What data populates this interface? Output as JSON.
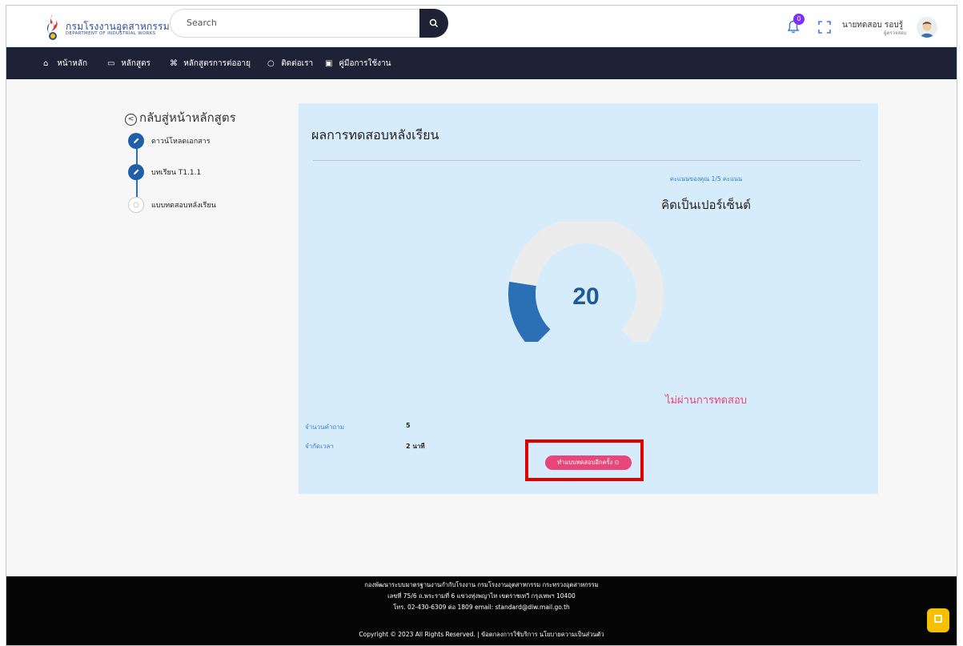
{
  "header": {
    "logo_th": "กรมโรงงานอุตสาหกรรม",
    "logo_en": "DEPARTMENT OF INDUSTRIAL WORKS",
    "search_placeholder": "Search",
    "notification_count": "0",
    "user_name": "นายทดสอบ รอบรู้",
    "user_role": "ผู้ตรวจสอบ"
  },
  "nav": {
    "items": [
      {
        "icon": "home-icon",
        "label": "หน้าหลัก"
      },
      {
        "icon": "monitor-icon",
        "label": "หลักสูตร"
      },
      {
        "icon": "command-icon",
        "label": "หลักสูตรการต่ออายุ"
      },
      {
        "icon": "chat-icon",
        "label": "ติดต่อเรา"
      },
      {
        "icon": "manual-icon",
        "label": "คู่มือการใช้งาน"
      }
    ]
  },
  "sidebar": {
    "back_label": "กลับสู่หน้าหลักสูตร",
    "steps": [
      {
        "label": "ดาวน์โหลดเอกสาร",
        "state": "done"
      },
      {
        "label": "บทเรียน T1.1.1",
        "state": "done"
      },
      {
        "label": "แบบทดสอบหลังเรียน",
        "state": "current"
      }
    ]
  },
  "result": {
    "title": "ผลการทดสอบหลังเรียน",
    "score_text": "คะแนนของคุณ 1/5 คะแนน",
    "percent_label": "คิดเป็นเปอร์เซ็นต์",
    "percent_value": "20",
    "percent_fraction": 0.2,
    "status_text": "ไม่ผ่านการทดสอบ",
    "questions_label": "จำนวนคำถาม",
    "questions_value": "5",
    "time_label": "จำกัดเวลา",
    "time_value": "2 นาที",
    "retry_label": "ทำแบบทดสอบอีกครั้ง"
  },
  "footer": {
    "line1": "กองพัฒนาระบบมาตรฐานงานกำกับโรงงาน กรมโรงงานอุตสาหกรรม กระทรวงอุตสาหกรรม",
    "line2": "เลขที่ 75/6 ถ.พระรามที่ 6 แขวงทุ่งพญาไท เขตราชเทวี กรุงเทพฯ 10400",
    "line3": "โทร. 02-430-6309 ต่อ 1809 email: standard@diw.mail.go.th",
    "copyright": "Copyright © 2023 All Rights Reserved. | ข้อตกลงการใช้บริการ นโยบายความเป็นส่วนตัว"
  },
  "colors": {
    "nav_bg": "#1e2236",
    "panel_bg": "#d7ecfa",
    "gauge_fill": "#2b6fb5",
    "gauge_track": "#ececec",
    "fail_text": "#e8457b",
    "accent_blue": "#2a7fd4",
    "highlight_box": "#e00000"
  }
}
